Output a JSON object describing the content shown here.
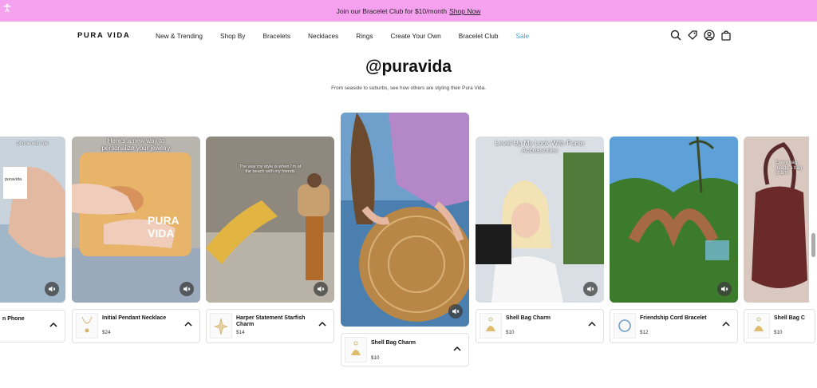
{
  "promo": {
    "text": "Join our Bracelet Club for $10/month",
    "link": "Shop Now"
  },
  "nav": {
    "logo": "PURA VIDA",
    "items": [
      "New & Trending",
      "Shop By",
      "Bracelets",
      "Necklaces",
      "Rings",
      "Create Your Own",
      "Bracelet Club",
      "Sale"
    ]
  },
  "section": {
    "title": "@puravida",
    "subtitle": "From seaside to suburbs, see how others are styling their Pura Vida."
  },
  "cards": [
    {
      "overlay": "phone with me",
      "product": "n Phone",
      "price": ""
    },
    {
      "overlay": "Here's a new way to personalize your jewelry",
      "product": "Initial Pendant Necklace",
      "price": "$24"
    },
    {
      "overlay": "The way my style is when I'm at the beach with my friends",
      "product": "Harper Statement Starfish Charm",
      "price": "$14"
    },
    {
      "overlay": "",
      "product": "Shell Bag Charm",
      "price": "$10"
    },
    {
      "overlay": "Level Up My Look With Purse Accessories",
      "product": "Shell Bag Charm",
      "price": "$10"
    },
    {
      "overlay": "",
      "product": "Friendship Cord Bracelet",
      "price": "$12"
    },
    {
      "overlay": "Every bag needs a bag charm",
      "product": "Shell Bag C",
      "price": "$10"
    }
  ],
  "colors": {
    "promo_bg": "#f5a1ef",
    "sale": "#3a9fd8"
  }
}
